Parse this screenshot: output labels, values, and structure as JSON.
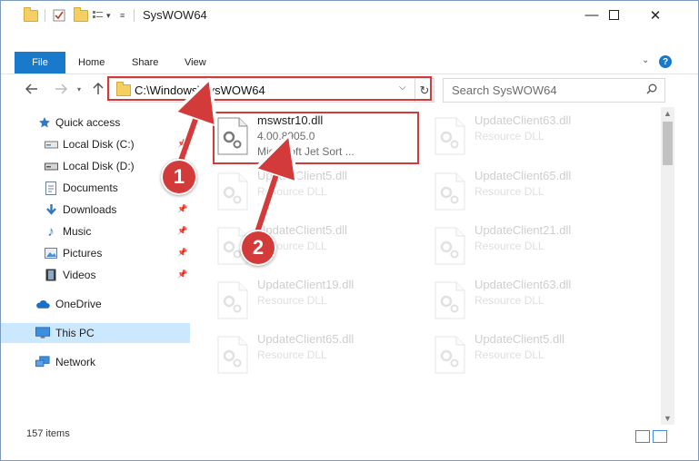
{
  "window": {
    "title": "SysWOW64"
  },
  "ribbon": {
    "tabs": [
      "File",
      "Home",
      "Share",
      "View"
    ]
  },
  "address": {
    "path": "C:\\Windows\\SysWOW64"
  },
  "search": {
    "placeholder": "Search SysWOW64"
  },
  "nav": {
    "items": [
      {
        "label": "Quick access",
        "icon": "star-icon",
        "pinned": false
      },
      {
        "label": "Local Disk (C:)",
        "icon": "drive-icon",
        "pinned": true
      },
      {
        "label": "Local Disk (D:)",
        "icon": "drive-icon",
        "pinned": true
      },
      {
        "label": "Documents",
        "icon": "documents-icon",
        "pinned": true
      },
      {
        "label": "Downloads",
        "icon": "download-icon",
        "pinned": true
      },
      {
        "label": "Music",
        "icon": "music-icon",
        "pinned": true
      },
      {
        "label": "Pictures",
        "icon": "pictures-icon",
        "pinned": true
      },
      {
        "label": "Videos",
        "icon": "videos-icon",
        "pinned": true
      },
      {
        "label": "OneDrive",
        "icon": "cloud-icon",
        "pinned": false
      },
      {
        "label": "This PC",
        "icon": "computer-icon",
        "pinned": false,
        "selected": true
      },
      {
        "label": "Network",
        "icon": "network-icon",
        "pinned": false
      }
    ]
  },
  "files": [
    {
      "name": "mswstr10.dll",
      "version": "4.00.8905.0",
      "desc": "Microsoft Jet Sort ...",
      "highlighted": true
    },
    {
      "name": "UpdateClient63.dll",
      "desc": "Resource DLL"
    },
    {
      "name": "UpdateClient5.dll",
      "desc": "Resource DLL"
    },
    {
      "name": "UpdateClient65.dll",
      "desc": "Resource DLL"
    },
    {
      "name": "UpdateClient5.dll",
      "desc": "Resource DLL"
    },
    {
      "name": "UpdateClient21.dll",
      "desc": "Resource DLL"
    },
    {
      "name": "UpdateClient19.dll",
      "desc": "Resource DLL"
    },
    {
      "name": "UpdateClient63.dll",
      "desc": "Resource DLL"
    },
    {
      "name": "UpdateClient65.dll",
      "desc": "Resource DLL"
    },
    {
      "name": "UpdateClient5.dll",
      "desc": "Resource DLL"
    }
  ],
  "status": {
    "count": "157 items"
  },
  "callouts": [
    "1",
    "2"
  ],
  "colors": {
    "accent": "#1979ca",
    "highlight": "#d33b3b",
    "selected": "#cce8ff"
  }
}
